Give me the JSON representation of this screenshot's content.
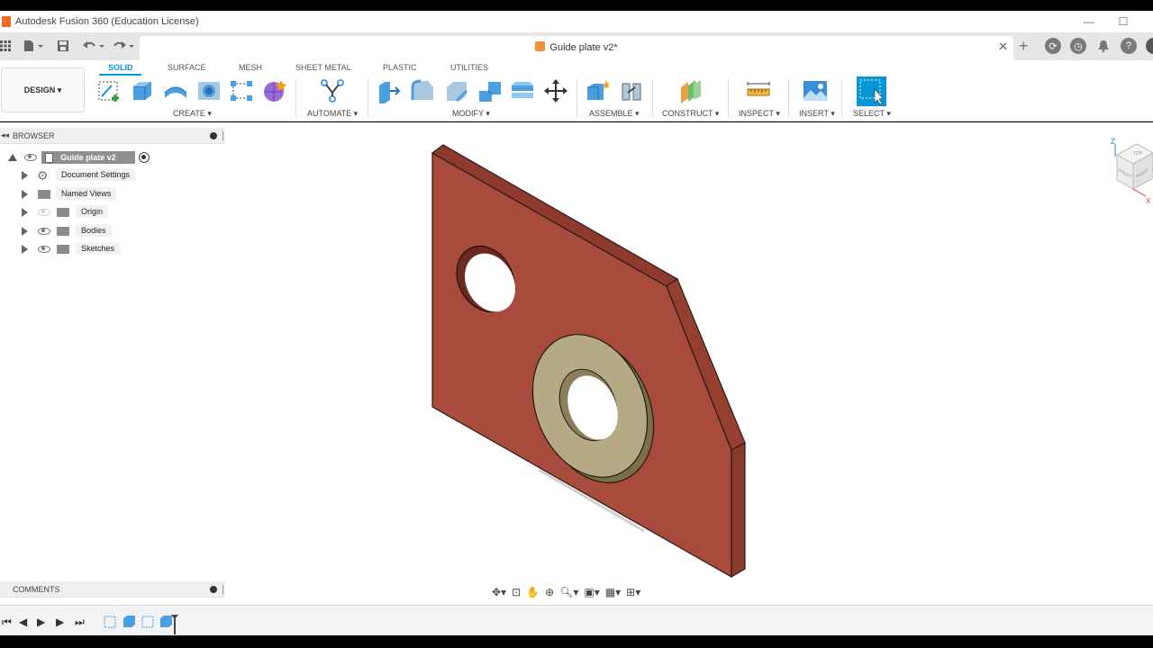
{
  "window": {
    "title": "Autodesk Fusion 360 (Education License)"
  },
  "document": {
    "tab_title": "Guide plate v2*"
  },
  "workspace": {
    "label": "DESIGN"
  },
  "tabs": [
    "SOLID",
    "SURFACE",
    "MESH",
    "SHEET METAL",
    "PLASTIC",
    "UTILITIES"
  ],
  "groups": {
    "create": "CREATE",
    "automate": "AUTOMATE",
    "modify": "MODIFY",
    "assemble": "ASSEMBLE",
    "construct": "CONSTRUCT",
    "inspect": "INSPECT",
    "insert": "INSERT",
    "select": "SELECT"
  },
  "browser": {
    "title": "BROWSER",
    "root": "Guide plate v2",
    "items": [
      "Document Settings",
      "Named Views",
      "Origin",
      "Bodies",
      "Sketches"
    ]
  },
  "comments": {
    "title": "COMMENTS"
  },
  "viewcube": {
    "top": "TOP",
    "front": "FRONT",
    "right": "RIGHT",
    "z": "Z",
    "x": "X"
  },
  "colors": {
    "plate": "#a84a3c",
    "washer": "#b5aa85",
    "accent": "#0696d7"
  }
}
